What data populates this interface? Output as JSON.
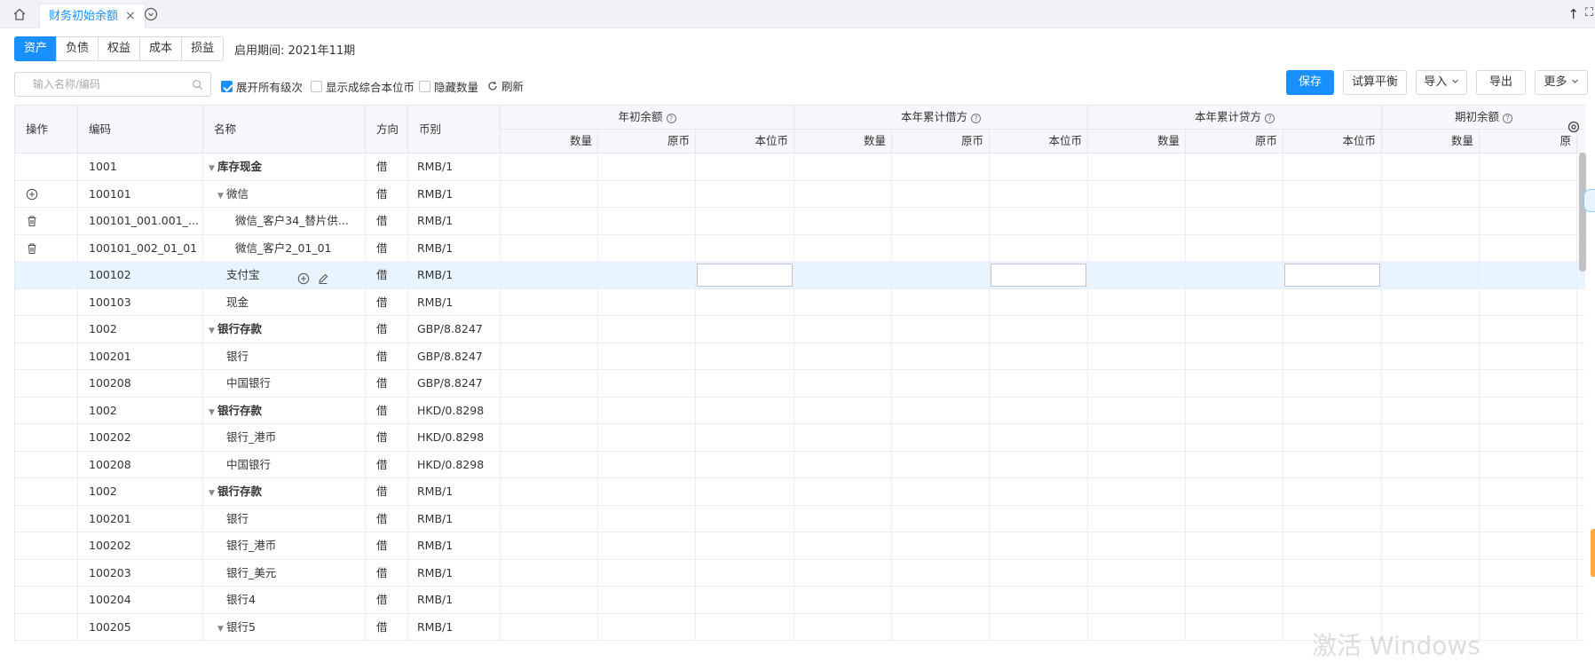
{
  "tabbar": {
    "home_icon": "home-icon",
    "active_tab": "财务初始余额",
    "close_symbol": "×",
    "up_symbol": "↑",
    "fullscreen_symbol": "⛶"
  },
  "categories": [
    "资产",
    "负债",
    "权益",
    "成本",
    "损益"
  ],
  "active_category": "资产",
  "period_label": "启用期间: 2021年11期",
  "toolbar": {
    "search_placeholder": "输入名称/编码",
    "search_value": "",
    "expand_all": {
      "label": "展开所有级次",
      "checked": true
    },
    "show_combined": {
      "label": "显示成综合本位币",
      "checked": false
    },
    "hide_quantity": {
      "label": "隐藏数量",
      "checked": false
    },
    "refresh_label": "刷新",
    "save_label": "保存",
    "trial_label": "试算平衡",
    "import_label": "导入",
    "export_label": "导出",
    "more_label": "更多"
  },
  "table": {
    "headers": {
      "op": "操作",
      "code": "编码",
      "name": "名称",
      "direction": "方向",
      "currency": "币别",
      "group1": "年初余额",
      "group2": "本年累计借方",
      "group3": "本年累计贷方",
      "group4": "期初余额",
      "qty": "数量",
      "orig": "原币",
      "base": "本位币",
      "orig_partial": "原"
    },
    "rows": [
      {
        "code": "1001",
        "name": "库存现金",
        "direction": "借",
        "currency": "RMB/1"
      },
      {
        "code": "100101",
        "name": "微信",
        "direction": "借",
        "currency": "RMB/1"
      },
      {
        "code": "100101_001.001_...",
        "name": "微信_客户34_替片供...",
        "direction": "借",
        "currency": "RMB/1"
      },
      {
        "code": "100101_002_01_01",
        "name": "微信_客户2_01_01",
        "direction": "借",
        "currency": "RMB/1"
      },
      {
        "code": "100102",
        "name": "支付宝",
        "direction": "借",
        "currency": "RMB/1"
      },
      {
        "code": "100103",
        "name": "现金",
        "direction": "借",
        "currency": "RMB/1"
      },
      {
        "code": "1002",
        "name": "银行存款",
        "direction": "借",
        "currency": "GBP/8.8247"
      },
      {
        "code": "100201",
        "name": "银行",
        "direction": "借",
        "currency": "GBP/8.8247"
      },
      {
        "code": "100208",
        "name": "中国银行",
        "direction": "借",
        "currency": "GBP/8.8247"
      },
      {
        "code": "1002",
        "name": "银行存款",
        "direction": "借",
        "currency": "HKD/0.8298"
      },
      {
        "code": "100202",
        "name": "银行_港币",
        "direction": "借",
        "currency": "HKD/0.8298"
      },
      {
        "code": "100208",
        "name": "中国银行",
        "direction": "借",
        "currency": "HKD/0.8298"
      },
      {
        "code": "1002",
        "name": "银行存款",
        "direction": "借",
        "currency": "RMB/1"
      },
      {
        "code": "100201",
        "name": "银行",
        "direction": "借",
        "currency": "RMB/1"
      },
      {
        "code": "100202",
        "name": "银行_港币",
        "direction": "借",
        "currency": "RMB/1"
      },
      {
        "code": "100203",
        "name": "银行_美元",
        "direction": "借",
        "currency": "RMB/1"
      },
      {
        "code": "100204",
        "name": "银行4",
        "direction": "借",
        "currency": "RMB/1"
      },
      {
        "code": "100205",
        "name": "银行5",
        "direction": "借",
        "currency": "RMB/1"
      }
    ]
  },
  "watermark": "激活 Windows"
}
